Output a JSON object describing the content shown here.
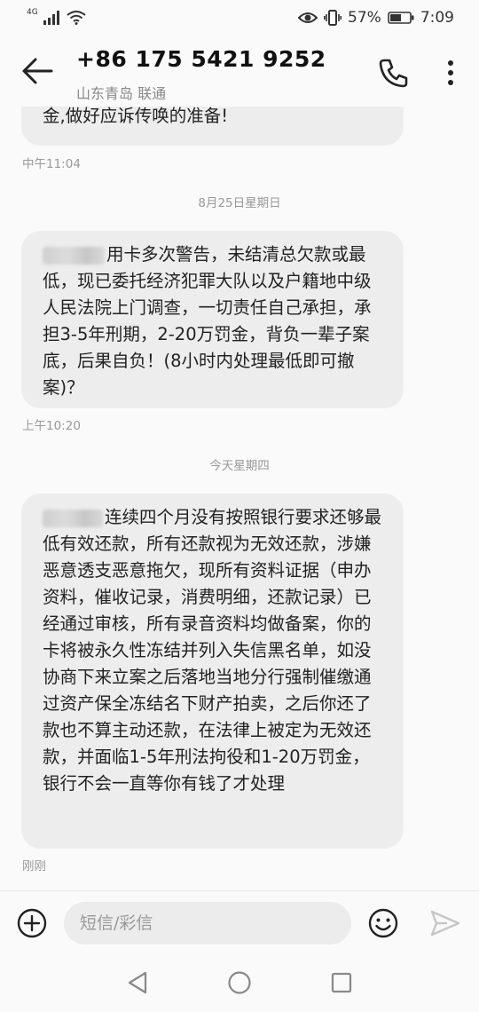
{
  "status_bar": {
    "network": "4G",
    "battery_percent": "57%",
    "time": "7:09"
  },
  "header": {
    "contact_number": "+86 175 5421 9252",
    "contact_location": "山东青岛 联通"
  },
  "messages": [
    {
      "text": "金,做好应诉传唤的准备!",
      "time": "中午11:04"
    },
    {
      "date_separator": "8月25日星期日",
      "redacted_prefix": true,
      "text": "用卡多次警告，未结清总欠款或最低，现已委托经济犯罪大队以及户籍地中级人民法院上门调查，一切责任自己承担，承担3-5年刑期，2-20万罚金，背负一辈子案底，后果自负！(8小时内处理最低即可撤案)？",
      "time": "上午10:20"
    },
    {
      "date_separator": "今天星期四",
      "redacted_prefix": true,
      "text": "连续四个月没有按照银行要求还够最低有效还款，所有还款视为无效还款，涉嫌恶意透支恶意拖欠，现所有资料证据（申办资料，催收记录，消费明细，还款记录）已经通过审核，所有录音资料均做备案，你的卡将被永久性冻结并列入失信黑名单，如没协商下来立案之后落地当地分行强制催缴通过资产保全冻结名下财产拍卖，之后你还了款也不算主动还款，在法律上被定为无效还款，并面临1-5年刑法拘役和1-20万罚金，银行不会一直等你有钱了才处理",
      "time": "刚刚"
    }
  ],
  "input_bar": {
    "placeholder": "短信/彩信"
  },
  "icons": {
    "back": "arrow-left-icon",
    "call": "phone-icon",
    "more": "more-vertical-icon",
    "add": "plus-circle-icon",
    "emoji": "smiley-icon",
    "send": "send-icon"
  },
  "colors": {
    "bubble": "#ededed",
    "background": "#fafafa",
    "muted_text": "#999999"
  }
}
